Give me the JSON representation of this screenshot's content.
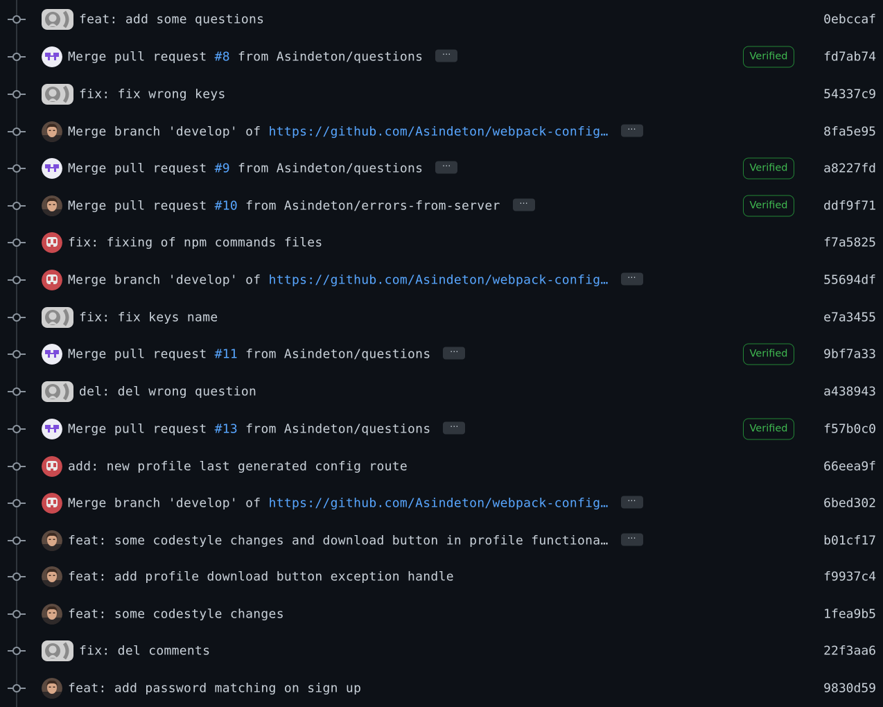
{
  "ellipsis_label": "···",
  "verified_label": "Verified",
  "commits": [
    {
      "avatar": "github-default",
      "parts": [
        {
          "t": "feat: add some questions"
        }
      ],
      "ellipsis": false,
      "verified": false,
      "sha": "0ebccaf"
    },
    {
      "avatar": "purple-bot",
      "parts": [
        {
          "t": "Merge pull request "
        },
        {
          "t": "#8",
          "link": true
        },
        {
          "t": " from Asindeton/questions"
        }
      ],
      "ellipsis": true,
      "verified": true,
      "sha": "fd7ab74"
    },
    {
      "avatar": "github-default",
      "parts": [
        {
          "t": "fix: fix wrong keys"
        }
      ],
      "ellipsis": false,
      "verified": false,
      "sha": "54337c9"
    },
    {
      "avatar": "photo-man",
      "parts": [
        {
          "t": "Merge branch 'develop' of "
        },
        {
          "t": "https://github.com/Asindeton/webpack-config…",
          "link": true
        }
      ],
      "ellipsis": true,
      "verified": false,
      "sha": "8fa5e95"
    },
    {
      "avatar": "purple-bot",
      "parts": [
        {
          "t": "Merge pull request "
        },
        {
          "t": "#9",
          "link": true
        },
        {
          "t": " from Asindeton/questions"
        }
      ],
      "ellipsis": true,
      "verified": true,
      "sha": "a8227fd"
    },
    {
      "avatar": "photo-man",
      "parts": [
        {
          "t": "Merge pull request "
        },
        {
          "t": "#10",
          "link": true
        },
        {
          "t": " from Asindeton/errors-from-server"
        }
      ],
      "ellipsis": true,
      "verified": true,
      "sha": "ddf9f71"
    },
    {
      "avatar": "red-bot",
      "parts": [
        {
          "t": "fix: fixing of npm commands files"
        }
      ],
      "ellipsis": false,
      "verified": false,
      "sha": "f7a5825"
    },
    {
      "avatar": "red-bot",
      "parts": [
        {
          "t": "Merge branch 'develop' of "
        },
        {
          "t": "https://github.com/Asindeton/webpack-config…",
          "link": true
        }
      ],
      "ellipsis": true,
      "verified": false,
      "sha": "55694df"
    },
    {
      "avatar": "github-default",
      "parts": [
        {
          "t": "fix: fix keys name"
        }
      ],
      "ellipsis": false,
      "verified": false,
      "sha": "e7a3455"
    },
    {
      "avatar": "purple-bot",
      "parts": [
        {
          "t": "Merge pull request "
        },
        {
          "t": "#11",
          "link": true
        },
        {
          "t": " from Asindeton/questions"
        }
      ],
      "ellipsis": true,
      "verified": true,
      "sha": "9bf7a33"
    },
    {
      "avatar": "github-default",
      "parts": [
        {
          "t": "del: del wrong question"
        }
      ],
      "ellipsis": false,
      "verified": false,
      "sha": "a438943"
    },
    {
      "avatar": "purple-bot",
      "parts": [
        {
          "t": "Merge pull request "
        },
        {
          "t": "#13",
          "link": true
        },
        {
          "t": " from Asindeton/questions"
        }
      ],
      "ellipsis": true,
      "verified": true,
      "sha": "f57b0c0"
    },
    {
      "avatar": "red-bot",
      "parts": [
        {
          "t": "add: new profile last generated config route"
        }
      ],
      "ellipsis": false,
      "verified": false,
      "sha": "66eea9f"
    },
    {
      "avatar": "red-bot",
      "parts": [
        {
          "t": "Merge branch 'develop' of "
        },
        {
          "t": "https://github.com/Asindeton/webpack-config…",
          "link": true
        }
      ],
      "ellipsis": true,
      "verified": false,
      "sha": "6bed302"
    },
    {
      "avatar": "photo-man",
      "parts": [
        {
          "t": "feat: some codestyle changes and download button in profile functiona…"
        }
      ],
      "ellipsis": true,
      "verified": false,
      "sha": "b01cf17"
    },
    {
      "avatar": "photo-man",
      "parts": [
        {
          "t": "feat: add profile download button exception handle"
        }
      ],
      "ellipsis": false,
      "verified": false,
      "sha": "f9937c4"
    },
    {
      "avatar": "photo-man",
      "parts": [
        {
          "t": "feat: some codestyle changes"
        }
      ],
      "ellipsis": false,
      "verified": false,
      "sha": "1fea9b5"
    },
    {
      "avatar": "github-default",
      "parts": [
        {
          "t": "fix: del comments"
        }
      ],
      "ellipsis": false,
      "verified": false,
      "sha": "22f3aa6"
    },
    {
      "avatar": "photo-man",
      "parts": [
        {
          "t": "feat: add password matching on sign up"
        }
      ],
      "ellipsis": false,
      "verified": false,
      "sha": "9830d59"
    }
  ]
}
